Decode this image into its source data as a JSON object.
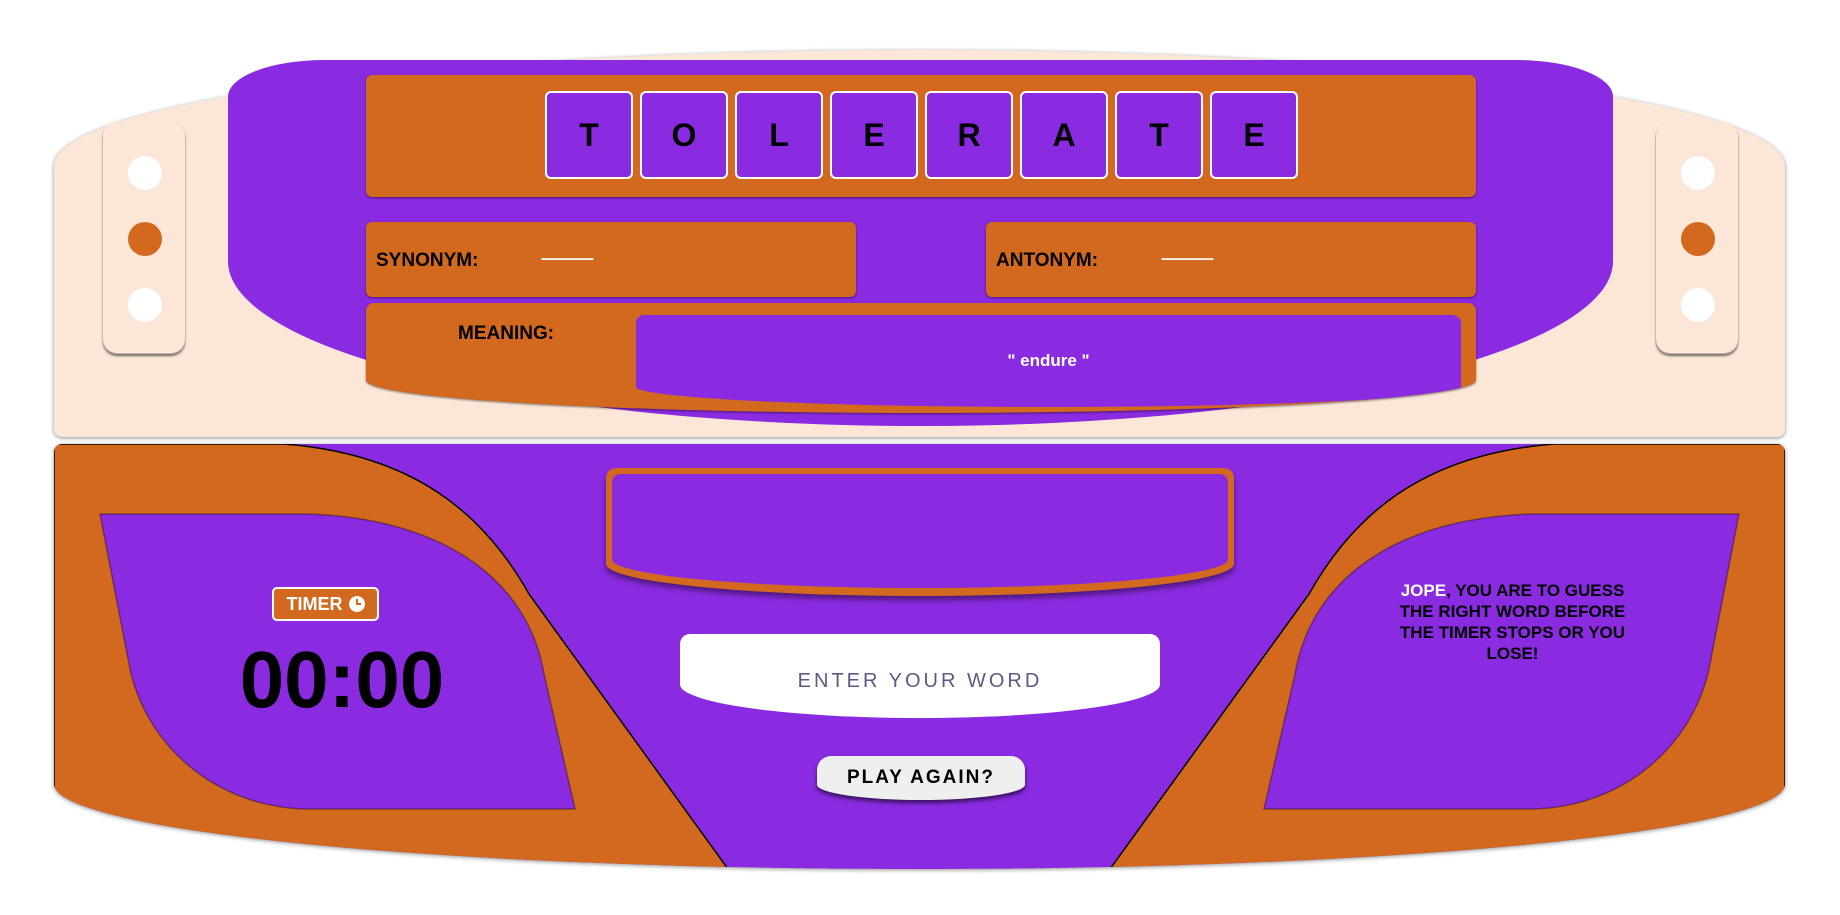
{
  "colors": {
    "purple": "#8a2be2",
    "orange": "#d2691e",
    "cream": "#fce6d7",
    "white": "#ffffff"
  },
  "word_tiles": [
    "T",
    "O",
    "L",
    "E",
    "R",
    "A",
    "T",
    "E"
  ],
  "synonym": {
    "label": "SYNONYM:",
    "value": "-------------"
  },
  "antonym": {
    "label": "ANTONYM:",
    "value": "-------------"
  },
  "meaning": {
    "label": "MEANING:",
    "value": "\" endure \""
  },
  "timer": {
    "label": "TIMER",
    "icon": "clock-icon",
    "value": "00:00"
  },
  "message": {
    "player": "JOPE",
    "text": ", YOU ARE TO GUESS THE RIGHT WORD BEFORE THE TIMER STOPS OR YOU LOSE!"
  },
  "input": {
    "placeholder": "ENTER YOUR WORD",
    "value": ""
  },
  "play_again": {
    "label": "PLAY AGAIN?"
  },
  "display_screen": {
    "text": ""
  }
}
